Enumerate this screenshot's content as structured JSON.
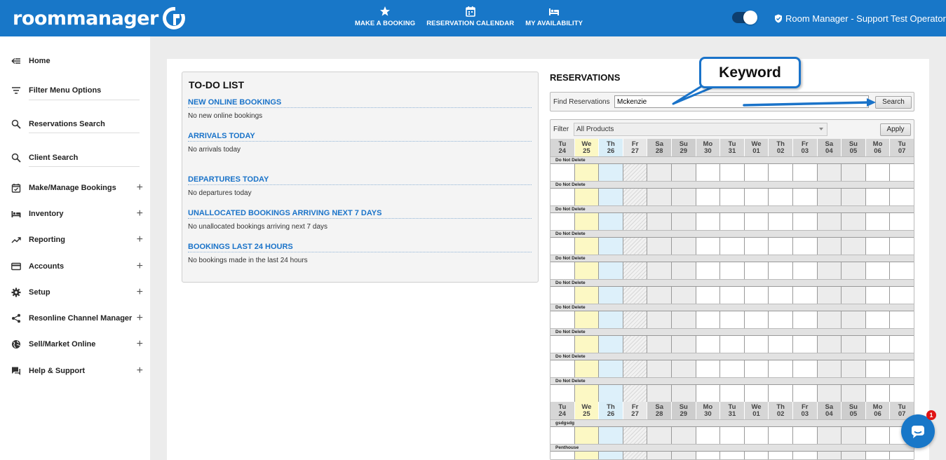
{
  "app": {
    "brand": "roommanager",
    "brand_color": "#1877c8"
  },
  "topnav": [
    {
      "label": "MAKE A BOOKING",
      "icon": "star-icon"
    },
    {
      "label": "RESERVATION CALENDAR",
      "icon": "calendar-icon"
    },
    {
      "label": "MY AVAILABILITY",
      "icon": "bed-icon"
    }
  ],
  "user": {
    "name": "Room Manager - Support Test Operator"
  },
  "sidebar": {
    "items": [
      {
        "label": "Home",
        "icon": "back-arrow-icon",
        "expandable": false
      },
      {
        "label": "Filter Menu Options",
        "icon": "filter-lines-icon",
        "expandable": false
      },
      {
        "label": "Reservations Search",
        "icon": "search-icon",
        "expandable": false
      },
      {
        "label": "Client Search",
        "icon": "search-icon",
        "expandable": false
      },
      {
        "label": "Make/Manage Bookings",
        "icon": "calendar-check-icon",
        "expandable": true
      },
      {
        "label": "Inventory",
        "icon": "bed-icon",
        "expandable": true
      },
      {
        "label": "Reporting",
        "icon": "trend-icon",
        "expandable": true
      },
      {
        "label": "Accounts",
        "icon": "credit-card-icon",
        "expandable": true
      },
      {
        "label": "Setup",
        "icon": "gear-icon",
        "expandable": true
      },
      {
        "label": "Resonline Channel Manager",
        "icon": "share-icon",
        "expandable": true
      },
      {
        "label": "Sell/Market Online",
        "icon": "globe-icon",
        "expandable": true
      },
      {
        "label": "Help & Support",
        "icon": "chat-icon",
        "expandable": true
      }
    ],
    "plus": "+"
  },
  "todo": {
    "title": "TO-DO LIST",
    "sections": [
      {
        "heading": "NEW ONLINE BOOKINGS",
        "body": "No new online bookings"
      },
      {
        "heading": "ARRIVALS TODAY",
        "body": "No arrivals today"
      },
      {
        "heading": "DEPARTURES TODAY",
        "body": "No departures today"
      },
      {
        "heading": "UNALLOCATED BOOKINGS ARRIVING NEXT 7 DAYS",
        "body": "No unallocated bookings arriving next 7 days"
      },
      {
        "heading": "BOOKINGS LAST 24 HOURS",
        "body": "No bookings made in the last 24 hours"
      }
    ]
  },
  "reservations": {
    "title": "RESERVATIONS",
    "find_label": "Find Reservations",
    "find_value": "Mckenzie",
    "search_label": "Search",
    "filter_label": "Filter",
    "filter_value": "All Products",
    "apply_label": "Apply",
    "days": [
      {
        "dow": "Tu",
        "day": "24",
        "kind": "normal"
      },
      {
        "dow": "We",
        "day": "25",
        "kind": "we"
      },
      {
        "dow": "Th",
        "day": "26",
        "kind": "th"
      },
      {
        "dow": "Fr",
        "day": "27",
        "kind": "fr"
      },
      {
        "dow": "Sa",
        "day": "28",
        "kind": "wkend"
      },
      {
        "dow": "Su",
        "day": "29",
        "kind": "wkend"
      },
      {
        "dow": "Mo",
        "day": "30",
        "kind": "normal"
      },
      {
        "dow": "Tu",
        "day": "31",
        "kind": "normal"
      },
      {
        "dow": "We",
        "day": "01",
        "kind": "normal"
      },
      {
        "dow": "Th",
        "day": "02",
        "kind": "normal"
      },
      {
        "dow": "Fr",
        "day": "03",
        "kind": "normal"
      },
      {
        "dow": "Sa",
        "day": "04",
        "kind": "wkend"
      },
      {
        "dow": "Su",
        "day": "05",
        "kind": "wkend"
      },
      {
        "dow": "Mo",
        "day": "06",
        "kind": "normal"
      },
      {
        "dow": "Tu",
        "day": "07",
        "kind": "normal"
      }
    ],
    "group1_rooms": [
      "Do Not Delete",
      "Do Not Delete",
      "Do Not Delete",
      "Do Not Delete",
      "Do Not Delete",
      "Do Not Delete",
      "Do Not Delete",
      "Do Not Delete",
      "Do Not Delete",
      "Do Not Delete"
    ],
    "group2_rooms": [
      "gsdgsdg",
      "Penthouse"
    ]
  },
  "annotation": {
    "label": "Keyword",
    "color": "#1a73c9"
  },
  "chat": {
    "badge": "1"
  }
}
